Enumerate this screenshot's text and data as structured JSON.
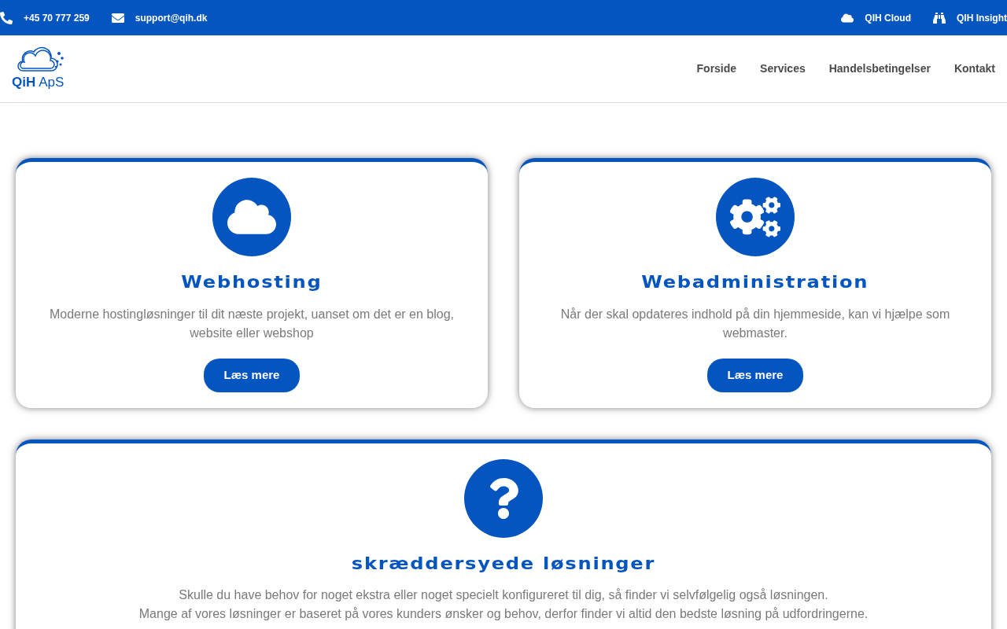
{
  "topbar": {
    "left": [
      {
        "kind": "phone",
        "label": "+45 70 777 259"
      },
      {
        "kind": "mail",
        "label": "support@qih.dk"
      }
    ],
    "right": [
      {
        "kind": "cloud",
        "label": "QIH Cloud"
      },
      {
        "kind": "binoculars",
        "label": "QIH Insight"
      }
    ]
  },
  "header": {
    "logo": {
      "brand": "QiH",
      "suffix": "ApS"
    },
    "nav": [
      {
        "label": "Forside"
      },
      {
        "label": "Services"
      },
      {
        "label": "Handelsbetingelser"
      },
      {
        "label": "Kontakt"
      }
    ]
  },
  "cards": [
    {
      "kind": "cloud",
      "title": "Webhosting",
      "text": [
        "Moderne hostingløsninger til dit næste projekt, uanset om det er en blog, website eller webshop"
      ],
      "button": "Læs mere"
    },
    {
      "kind": "gears",
      "title": "Webadministration",
      "text": [
        "Når der skal opdateres indhold på din hjemmeside, kan vi hjælpe som webmaster."
      ],
      "button": "Læs mere"
    },
    {
      "kind": "question",
      "title": "skræddersyede løsninger",
      "text": [
        "Skulle du have behov for noget ekstra eller noget specielt konfigureret til dig, så finder vi selvfølgelig også løsningen.",
        "Mange af vores løsninger er baseret på vores kunders ønsker og behov, derfor finder vi altid den bedste løsning på udfordringerne."
      ]
    }
  ]
}
